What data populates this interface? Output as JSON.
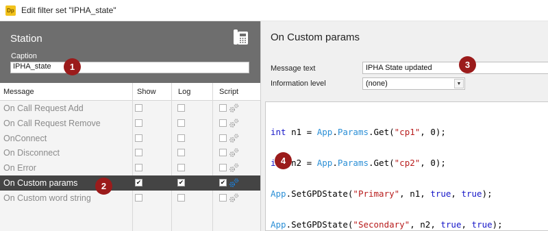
{
  "window": {
    "title": "Edit filter set \"IPHA_state\"",
    "app_icon_text": "Dp"
  },
  "station": {
    "title": "Station",
    "caption_label": "Caption",
    "caption_value": "IPHA_state"
  },
  "columns": {
    "message": "Message",
    "show": "Show",
    "log": "Log",
    "script": "Script"
  },
  "messages": [
    {
      "label": "On Call Request Add",
      "show": false,
      "log": false,
      "script": false,
      "selected": false
    },
    {
      "label": "On Call Request Remove",
      "show": false,
      "log": false,
      "script": false,
      "selected": false
    },
    {
      "label": "OnConnect",
      "show": false,
      "log": false,
      "script": false,
      "selected": false
    },
    {
      "label": "On Disconnect",
      "show": false,
      "log": false,
      "script": false,
      "selected": false
    },
    {
      "label": "On Error",
      "show": false,
      "log": false,
      "script": false,
      "selected": false
    },
    {
      "label": "On Custom params",
      "show": true,
      "log": true,
      "script": true,
      "selected": true
    },
    {
      "label": "On Custom word string",
      "show": false,
      "log": false,
      "script": false,
      "selected": false
    }
  ],
  "detail": {
    "title": "On Custom params",
    "message_text_label": "Message text",
    "message_text_value": "IPHA State updated",
    "info_level_label": "Information level",
    "info_level_value": "(none)"
  },
  "code": {
    "line1": {
      "t1": "int",
      "t2": " n1 = ",
      "t3": "App",
      "t4": ".",
      "t5": "Params",
      "t6": ".Get(",
      "t7": "\"cp1\"",
      "t8": ", 0);"
    },
    "line2": {
      "t1": "int",
      "t2": " n2 = ",
      "t3": "App",
      "t4": ".",
      "t5": "Params",
      "t6": ".Get(",
      "t7": "\"cp2\"",
      "t8": ", 0);"
    },
    "line3": {
      "t1": "App",
      "t2": ".SetGPDState(",
      "t3": "\"Primary\"",
      "t4": ", n1, ",
      "t5": "true",
      "t6": ", ",
      "t7": "true",
      "t8": ");"
    },
    "line4": {
      "t1": "App",
      "t2": ".SetGPDState(",
      "t3": "\"Secondary\"",
      "t4": ", n2, ",
      "t5": "true",
      "t6": ", ",
      "t7": "true",
      "t8": ");"
    }
  },
  "badges": {
    "b1": "1",
    "b2": "2",
    "b3": "3",
    "b4": "4"
  },
  "colors": {
    "badge": "#9b1b1b",
    "header": "#6e6e6e",
    "selected_row": "#444444",
    "keyword": "#1515c8",
    "string": "#b81c1c",
    "object": "#2b8fd6"
  }
}
